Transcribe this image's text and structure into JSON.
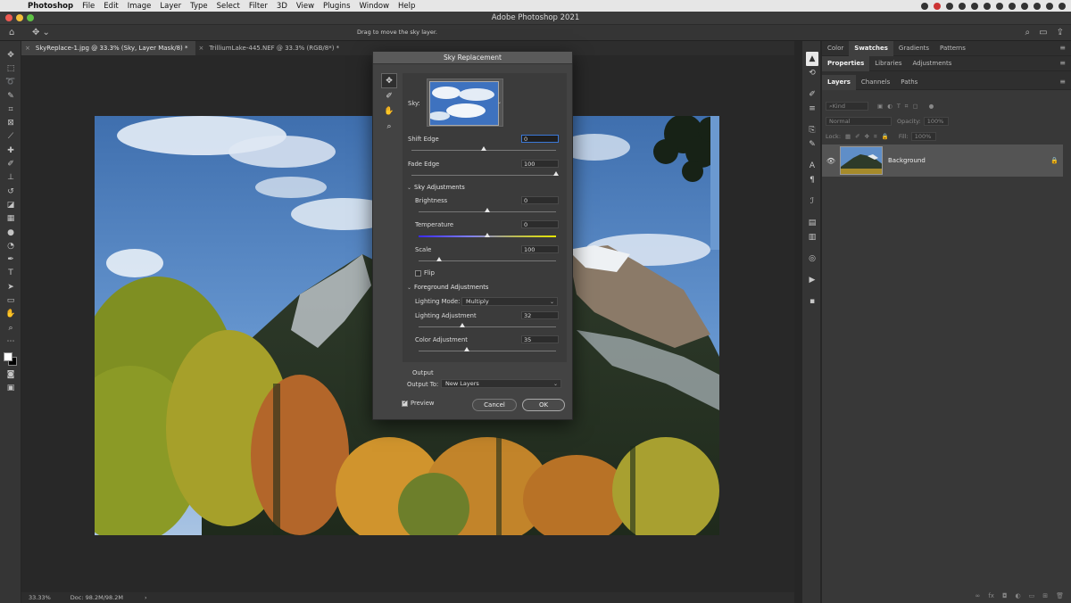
{
  "menubar": {
    "app_name": "Photoshop",
    "items": [
      "File",
      "Edit",
      "Image",
      "Layer",
      "Type",
      "Select",
      "Filter",
      "3D",
      "View",
      "Plugins",
      "Window",
      "Help"
    ]
  },
  "window": {
    "title": "Adobe Photoshop 2021"
  },
  "options_bar": {
    "hint": "Drag to move the sky layer."
  },
  "doc_tabs": [
    {
      "label": "SkyReplace-1.jpg @ 33.3% (Sky, Layer Mask/8) *",
      "active": true
    },
    {
      "label": "TrilliumLake-445.NEF @ 33.3% (RGB/8*) *",
      "active": false
    }
  ],
  "status": {
    "zoom": "33.33%",
    "doc": "Doc: 98.2M/98.2M",
    "arrow": "›"
  },
  "panels": {
    "top_tabs": [
      "Color",
      "Swatches",
      "Gradients",
      "Patterns"
    ],
    "top_active": "Swatches",
    "mid_tabs": [
      "Properties",
      "Libraries",
      "Adjustments"
    ],
    "mid_active": "Properties",
    "layer_tabs": [
      "Layers",
      "Channels",
      "Paths"
    ],
    "layer_active": "Layers",
    "filter_placeholder": "Kind",
    "blend_mode": "Normal",
    "opacity_label": "Opacity:",
    "opacity_value": "100%",
    "lock_label": "Lock:",
    "fill_label": "Fill:",
    "fill_value": "100%",
    "layer_name": "Background"
  },
  "dialog": {
    "title": "Sky Replacement",
    "sky_label": "Sky:",
    "shift_edge": {
      "label": "Shift Edge",
      "value": "0",
      "percent": 50
    },
    "fade_edge": {
      "label": "Fade Edge",
      "value": "100",
      "percent": 100
    },
    "sky_adjustments": {
      "heading": "Sky Adjustments",
      "brightness": {
        "label": "Brightness",
        "value": "0",
        "percent": 50
      },
      "temperature": {
        "label": "Temperature",
        "value": "0",
        "percent": 50
      },
      "scale": {
        "label": "Scale",
        "value": "100",
        "percent": 15
      },
      "flip_label": "Flip",
      "flip_checked": false
    },
    "foreground_adjustments": {
      "heading": "Foreground Adjustments",
      "lighting_mode_label": "Lighting Mode:",
      "lighting_mode": "Multiply",
      "lighting_adjustment": {
        "label": "Lighting Adjustment",
        "value": "32",
        "percent": 32
      },
      "color_adjustment": {
        "label": "Color Adjustment",
        "value": "35",
        "percent": 35
      }
    },
    "output": {
      "heading": "Output",
      "output_to_label": "Output To:",
      "output_to": "New Layers"
    },
    "preview_label": "Preview",
    "preview_checked": true,
    "cancel_label": "Cancel",
    "ok_label": "OK"
  },
  "colors": {
    "accent": "#3b78d8",
    "sky_blue": "#4f7fbd",
    "forest": "#2e4a2a",
    "aspen_gold": "#c89a2a"
  }
}
